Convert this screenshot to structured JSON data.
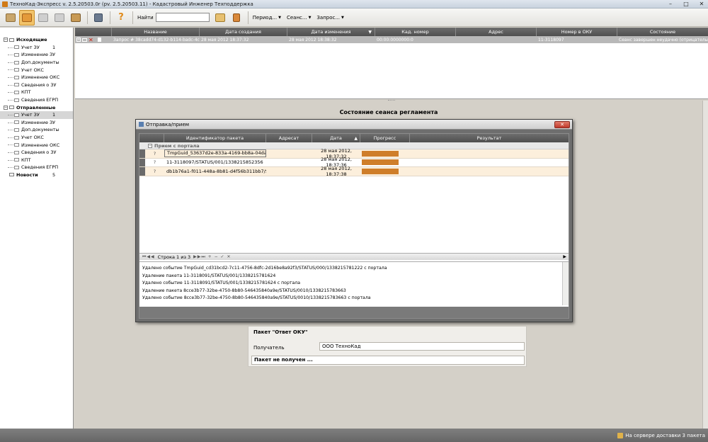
{
  "window": {
    "title": "ТехноКад-Экспресс v. 2.5.20503.0r (pv. 2.5.20503.11) - Кадастровый Инженер Техподдержка",
    "controls": [
      "–",
      "□",
      "✕"
    ]
  },
  "toolbar": {
    "find_label": "Найти",
    "search_value": "",
    "period_label": "Период...",
    "session_label": "Сеанс...",
    "request_label": "Запрос...",
    "help_label": "?"
  },
  "tree": {
    "groups": [
      {
        "label": "Исходящие",
        "items": [
          {
            "label": "Учет ЗУ",
            "count": "1"
          },
          {
            "label": "Изменение ЗУ",
            "count": ""
          },
          {
            "label": "Доп.документы",
            "count": ""
          },
          {
            "label": "Учет ОКС",
            "count": ""
          },
          {
            "label": "Изменение ОКС",
            "count": ""
          },
          {
            "label": "Сведения о ЗУ",
            "count": ""
          },
          {
            "label": "КПТ",
            "count": ""
          },
          {
            "label": "Сведения ЕГРП",
            "count": ""
          }
        ]
      },
      {
        "label": "Отправленные",
        "items": [
          {
            "label": "Учет ЗУ",
            "count": "1"
          },
          {
            "label": "Изменение ЗУ",
            "count": ""
          },
          {
            "label": "Доп.документы",
            "count": ""
          },
          {
            "label": "Учет ОКС",
            "count": ""
          },
          {
            "label": "Изменение ОКС",
            "count": ""
          },
          {
            "label": "Сведения о ЗУ",
            "count": ""
          },
          {
            "label": "КПТ",
            "count": ""
          },
          {
            "label": "Сведения ЕГРП",
            "count": ""
          }
        ]
      },
      {
        "label": "Новости",
        "count": "5",
        "items": []
      }
    ]
  },
  "requests_table": {
    "columns": [
      "Название",
      "Дата создания",
      "Дата изменения",
      "Кад. номер",
      "Адрес",
      "Номер в ОКУ",
      "Состояние"
    ],
    "rows": [
      {
        "name": "Запрос # 38cadd74-d132-b114-badc-4c421e...",
        "created": "28 мая 2012 18:37:32",
        "modified": "28 мая 2012 18:38:32",
        "cad_number": "00:00:0000000:0",
        "address": "",
        "oku_number": "11-3118097",
        "state": "Сеанс завершен неудачно (отрицательны..."
      }
    ]
  },
  "main": {
    "session_title": "Состояние сеанса регламента"
  },
  "dialog": {
    "title": "Отправка/прием",
    "close": "✕",
    "columns": [
      "Идентификатор пакета",
      "Адресат",
      "Дата",
      "Прогресс",
      "Результат"
    ],
    "group_label": "Прием с портала",
    "rows": [
      {
        "status": "?",
        "id": "TmpGuid_53637d2e-833a-4169-bb8a-04da53217a7...",
        "addressee": "",
        "date": "28 мая 2012, 18:37:32",
        "progress": 1.0,
        "result": ""
      },
      {
        "status": "?",
        "id": "11-3118097/STATUS/001/1338215852356",
        "addressee": "",
        "date": "28 мая 2012, 18:37:36",
        "progress": 1.0,
        "result": ""
      },
      {
        "status": "?",
        "id": "db1b76a1-f011-448a-8b81-d4f56b311bb7/STATUS/...",
        "addressee": "",
        "date": "28 мая 2012, 18:37:38",
        "progress": 1.0,
        "result": ""
      }
    ],
    "pager": {
      "label": "Строка 1 из 3"
    },
    "log": [
      "Удалено событие TmpGuid_cd31bcd2-7c11-4756-8dfc-2d16be8a92f3/STATUS/000/1338215781222 с портала",
      "Удаление пакета 11-3118091/STATUS/001/1338215781624",
      "Удалено событие 11-3118091/STATUS/001/1338215781624 с портала",
      "Удаление пакета 8cce3b77-32be-4750-8b80-546435840a9e/STATUS/0010/1338215783663",
      "Удалено событие 8cce3b77-32be-4750-8b80-546435840a9e/STATUS/0010/1338215783663 с портала"
    ]
  },
  "packet": {
    "title": "Пакет \"Ответ ОКУ\"",
    "recipient_label": "Получатель",
    "recipient_value": "ООО ТехноКад",
    "status": "Пакет не получен ..."
  },
  "statusbar": {
    "text": "На сервере доставки 3 пакета"
  },
  "colors": {
    "progress": "#cf7e2a",
    "header": "#5a5a5a",
    "active_button": "#f2c36a"
  }
}
